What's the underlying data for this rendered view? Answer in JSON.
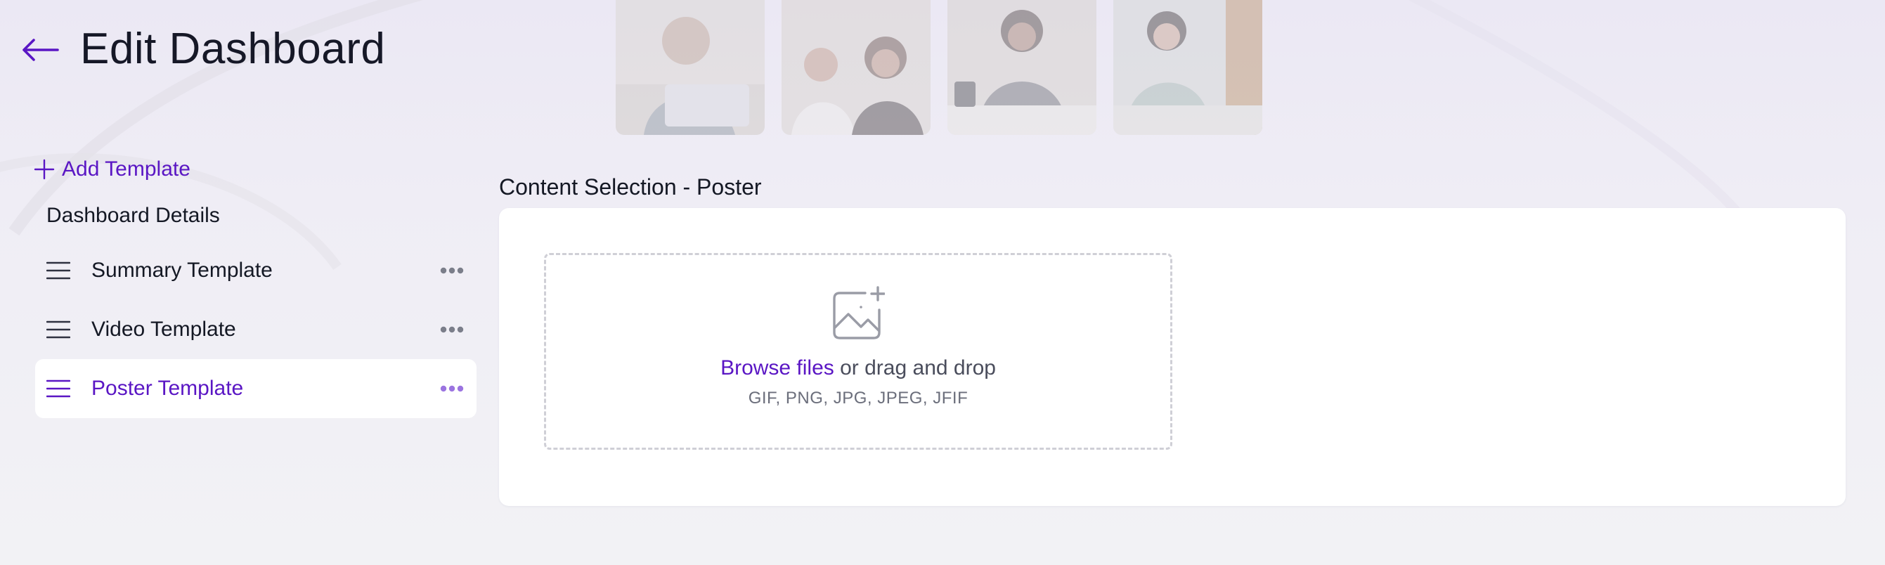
{
  "header": {
    "title": "Edit Dashboard"
  },
  "sidebar": {
    "add_template_label": "Add Template",
    "details_label": "Dashboard Details",
    "templates": [
      {
        "label": "Summary Template",
        "active": false
      },
      {
        "label": "Video Template",
        "active": false
      },
      {
        "label": "Poster Template",
        "active": true
      }
    ]
  },
  "content": {
    "section_title": "Content Selection - Poster",
    "upload": {
      "browse_label": "Browse files",
      "drag_text": " or drag and drop",
      "formats": "GIF, PNG, JPG, JPEG, JFIF"
    }
  },
  "colors": {
    "accent": "#5a16c4",
    "text": "#141824",
    "muted": "#6b6e7b",
    "background": "#f2f1f6",
    "card": "#ffffff"
  },
  "icons": {
    "back": "arrow-left-icon",
    "add": "plus-icon",
    "drag": "drag-handle-icon",
    "more": "more-horizontal-icon",
    "upload": "image-add-icon"
  }
}
